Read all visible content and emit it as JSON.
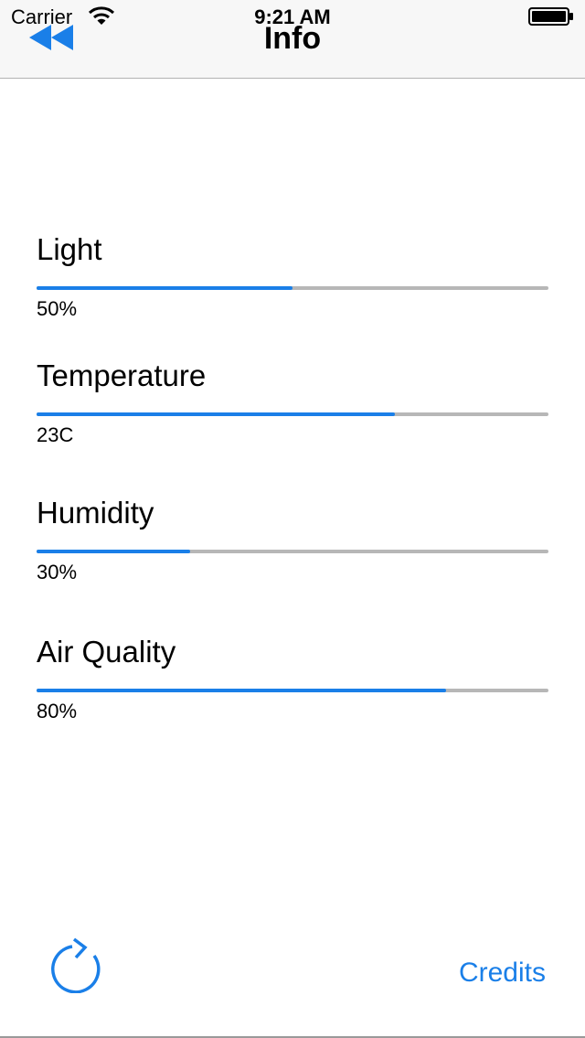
{
  "status_bar": {
    "carrier": "Carrier",
    "time": "9:21 AM",
    "icons": [
      "wifi-icon",
      "battery-icon"
    ]
  },
  "nav": {
    "title": "Info",
    "back_icon": "rewind-back-icon"
  },
  "metrics": [
    {
      "label": "Light",
      "value_text": "50%",
      "level": 0.5
    },
    {
      "label": "Temperature",
      "value_text": "23C",
      "level": 0.7
    },
    {
      "label": "Humidity",
      "value_text": "30%",
      "level": 0.3
    },
    {
      "label": "Air Quality",
      "value_text": "80%",
      "level": 0.8
    }
  ],
  "toolbar": {
    "refresh_icon": "refresh-icon",
    "credits_label": "Credits"
  },
  "colors": {
    "accent": "#1a7fe8",
    "track": "#b7b7b7",
    "nav_background": "#f7f7f7"
  }
}
